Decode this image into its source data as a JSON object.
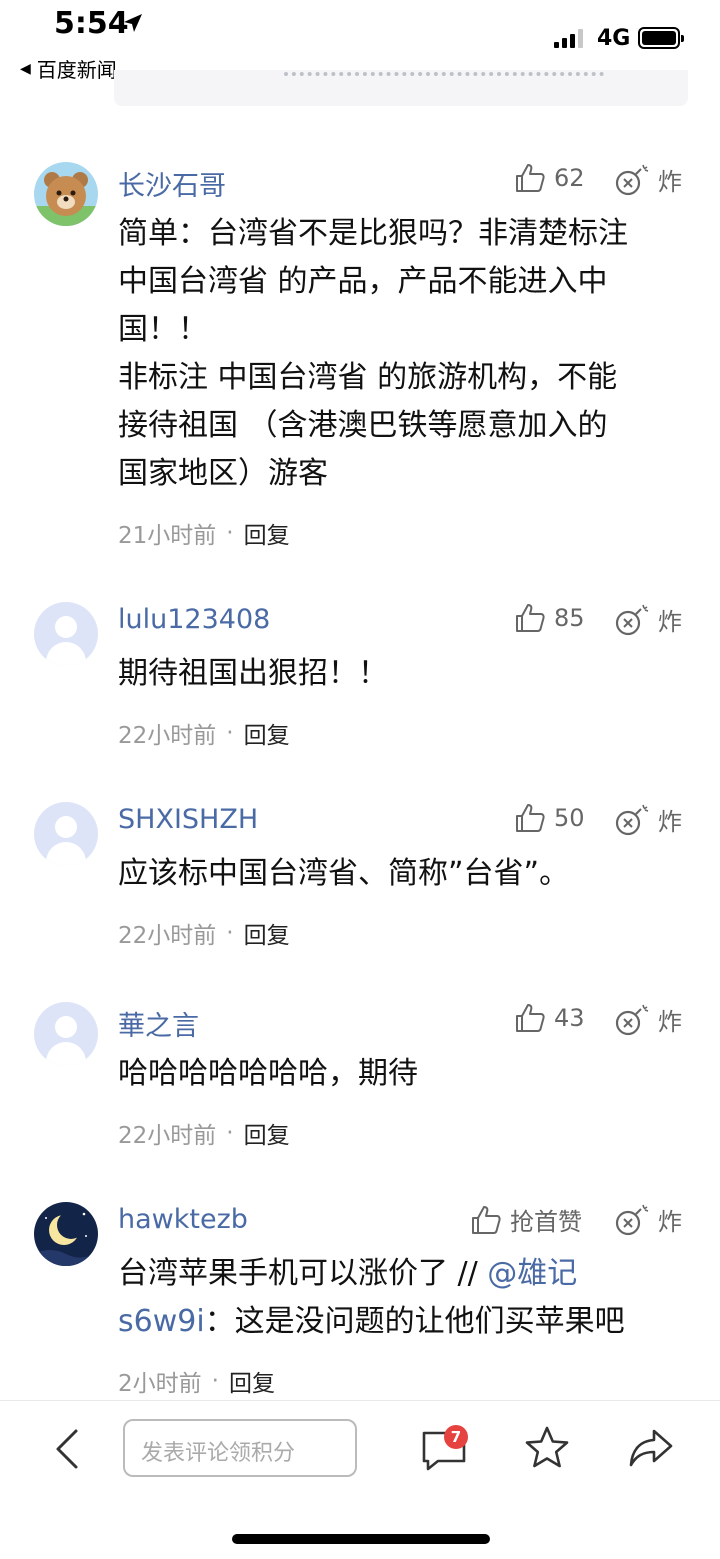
{
  "status_bar": {
    "time": "5:54",
    "network": "4G",
    "back_app": "百度新闻"
  },
  "comments": [
    {
      "username": "长沙石哥",
      "likes": "62",
      "bomb_label": "炸",
      "body_lines": [
        "简单：台湾省不是比狠吗？非清楚标注",
        "中国台湾省  的产品，产品不能进入中",
        "国！！",
        "非标注 中国台湾省 的旅游机构，不能",
        "接待祖国 （含港澳巴铁等愿意加入的",
        "国家地区）游客"
      ],
      "time": "21小时前",
      "reply": "回复"
    },
    {
      "username": "lulu123408",
      "likes": "85",
      "bomb_label": "炸",
      "body": "期待祖国出狠招！！",
      "time": "22小时前",
      "reply": "回复"
    },
    {
      "username": "SHXISHZH",
      "likes": "50",
      "bomb_label": "炸",
      "body": "应该标中国台湾省、简称”台省”。",
      "time": "22小时前",
      "reply": "回复"
    },
    {
      "username": "華之言",
      "likes": "43",
      "bomb_label": "炸",
      "body": "哈哈哈哈哈哈哈，期待",
      "time": "22小时前",
      "reply": "回复"
    },
    {
      "username": "hawktezb",
      "likes": "抢首赞",
      "bomb_label": "炸",
      "body_prefix": "台湾苹果手机可以涨价了 // ",
      "mention": "@雄记",
      "mention_line2": "s6w9i",
      "body_suffix": "：这是没问题的让他们买苹果吧",
      "time": "2小时前",
      "reply": "回复"
    }
  ],
  "bottom_bar": {
    "input_placeholder": "发表评论领积分",
    "message_badge": "7"
  }
}
